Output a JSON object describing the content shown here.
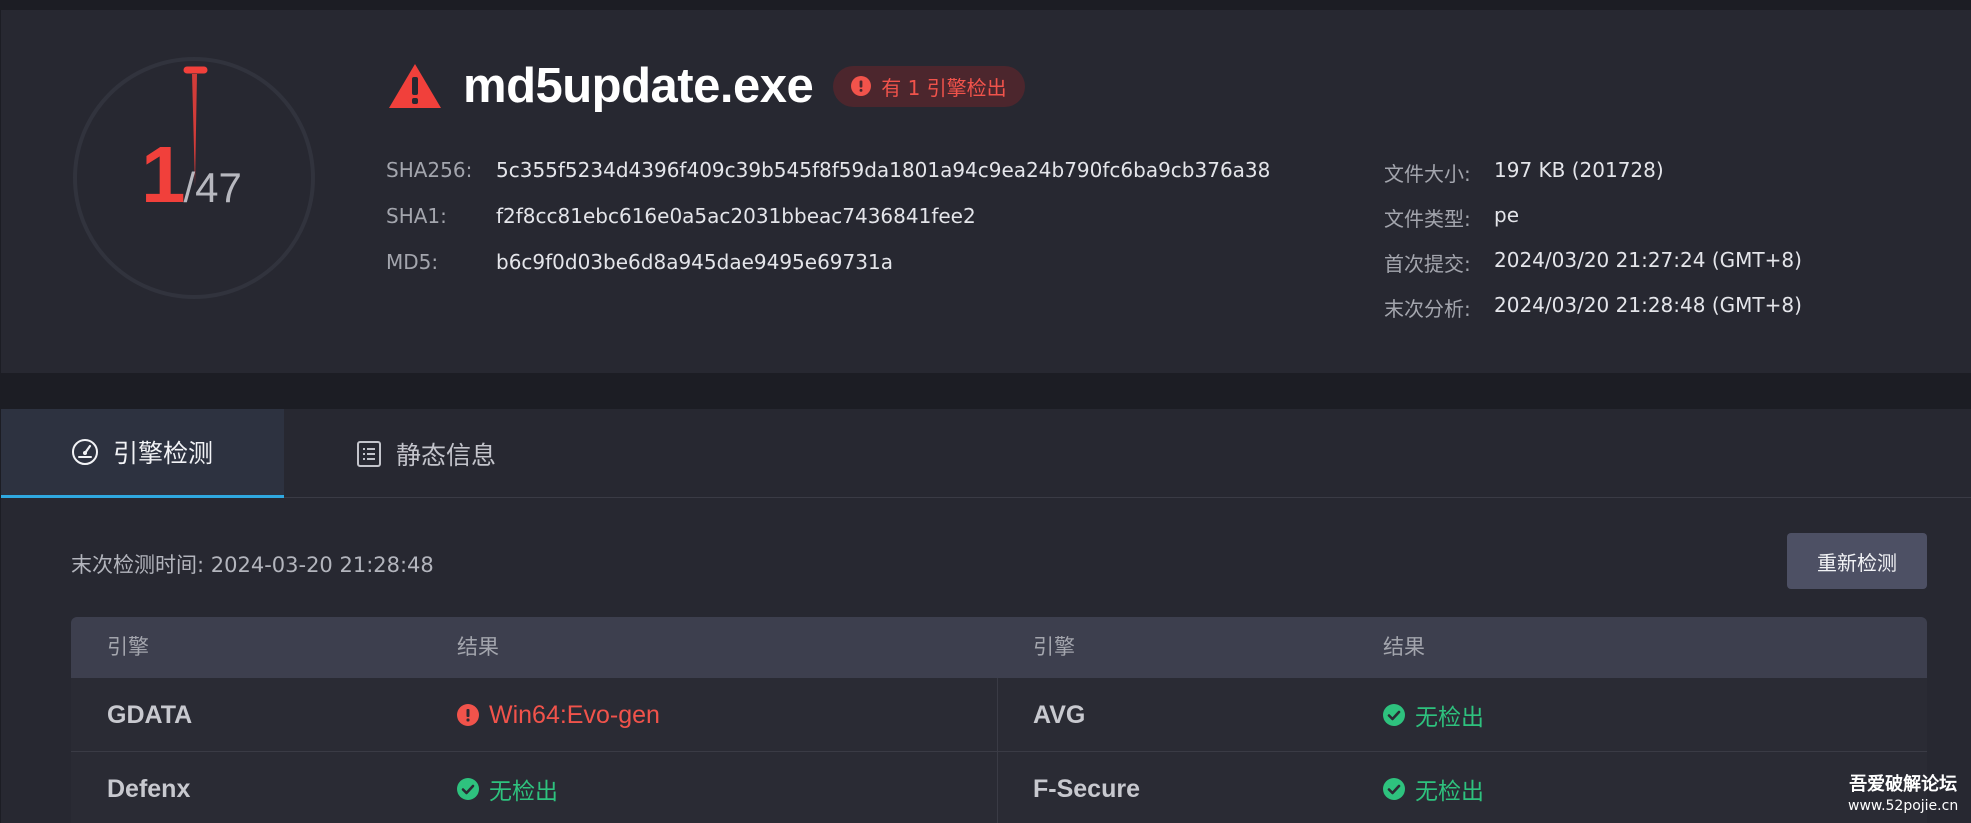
{
  "summary": {
    "detections": "1",
    "total_engines": "/47",
    "detection_fraction": 0.0213,
    "file_name": "md5update.exe",
    "badge_text": "有 1 引擎检出",
    "hashes": [
      {
        "label": "SHA256:",
        "value": "5c355f5234d4396f409c39b545f8f59da1801a94c9ea24b790fc6ba9cb376a38"
      },
      {
        "label": "SHA1:",
        "value": "f2f8cc81ebc616e0a5ac2031bbeac7436841fee2"
      },
      {
        "label": "MD5:",
        "value": "b6c9f0d03be6d8a945dae9495e69731a"
      }
    ],
    "meta": [
      {
        "label": "文件大小:",
        "value": "197 KB (201728)"
      },
      {
        "label": "文件类型:",
        "value": "pe"
      },
      {
        "label": "首次提交:",
        "value": "2024/03/20 21:27:24 (GMT+8)"
      },
      {
        "label": "末次分析:",
        "value": "2024/03/20 21:28:48 (GMT+8)"
      }
    ]
  },
  "tabs": [
    {
      "label": "引擎检测",
      "icon": "gauge-icon",
      "active": true
    },
    {
      "label": "静态信息",
      "icon": "document-list-icon",
      "active": false
    }
  ],
  "detection": {
    "last_scan": "末次检测时间: 2024-03-20 21:28:48",
    "rescan_label": "重新检测",
    "headers": [
      "引擎",
      "结果",
      "引擎",
      "结果"
    ],
    "rows": [
      [
        {
          "engine": "GDATA",
          "result": "Win64:Evo-gen",
          "status": "malicious"
        },
        {
          "engine": "AVG",
          "result": "无检出",
          "status": "clean"
        }
      ],
      [
        {
          "engine": "Defenx",
          "result": "无检出",
          "status": "clean"
        },
        {
          "engine": "F-Secure",
          "result": "无检出",
          "status": "clean"
        }
      ]
    ]
  },
  "watermark": {
    "title": "吾爱破解论坛",
    "url": "www.52pojie.cn"
  },
  "colors": {
    "danger": "#f1403b",
    "clean": "#2ec27e",
    "accent": "#2fa8e0",
    "panel": "#272831",
    "background": "#1c1d24"
  }
}
